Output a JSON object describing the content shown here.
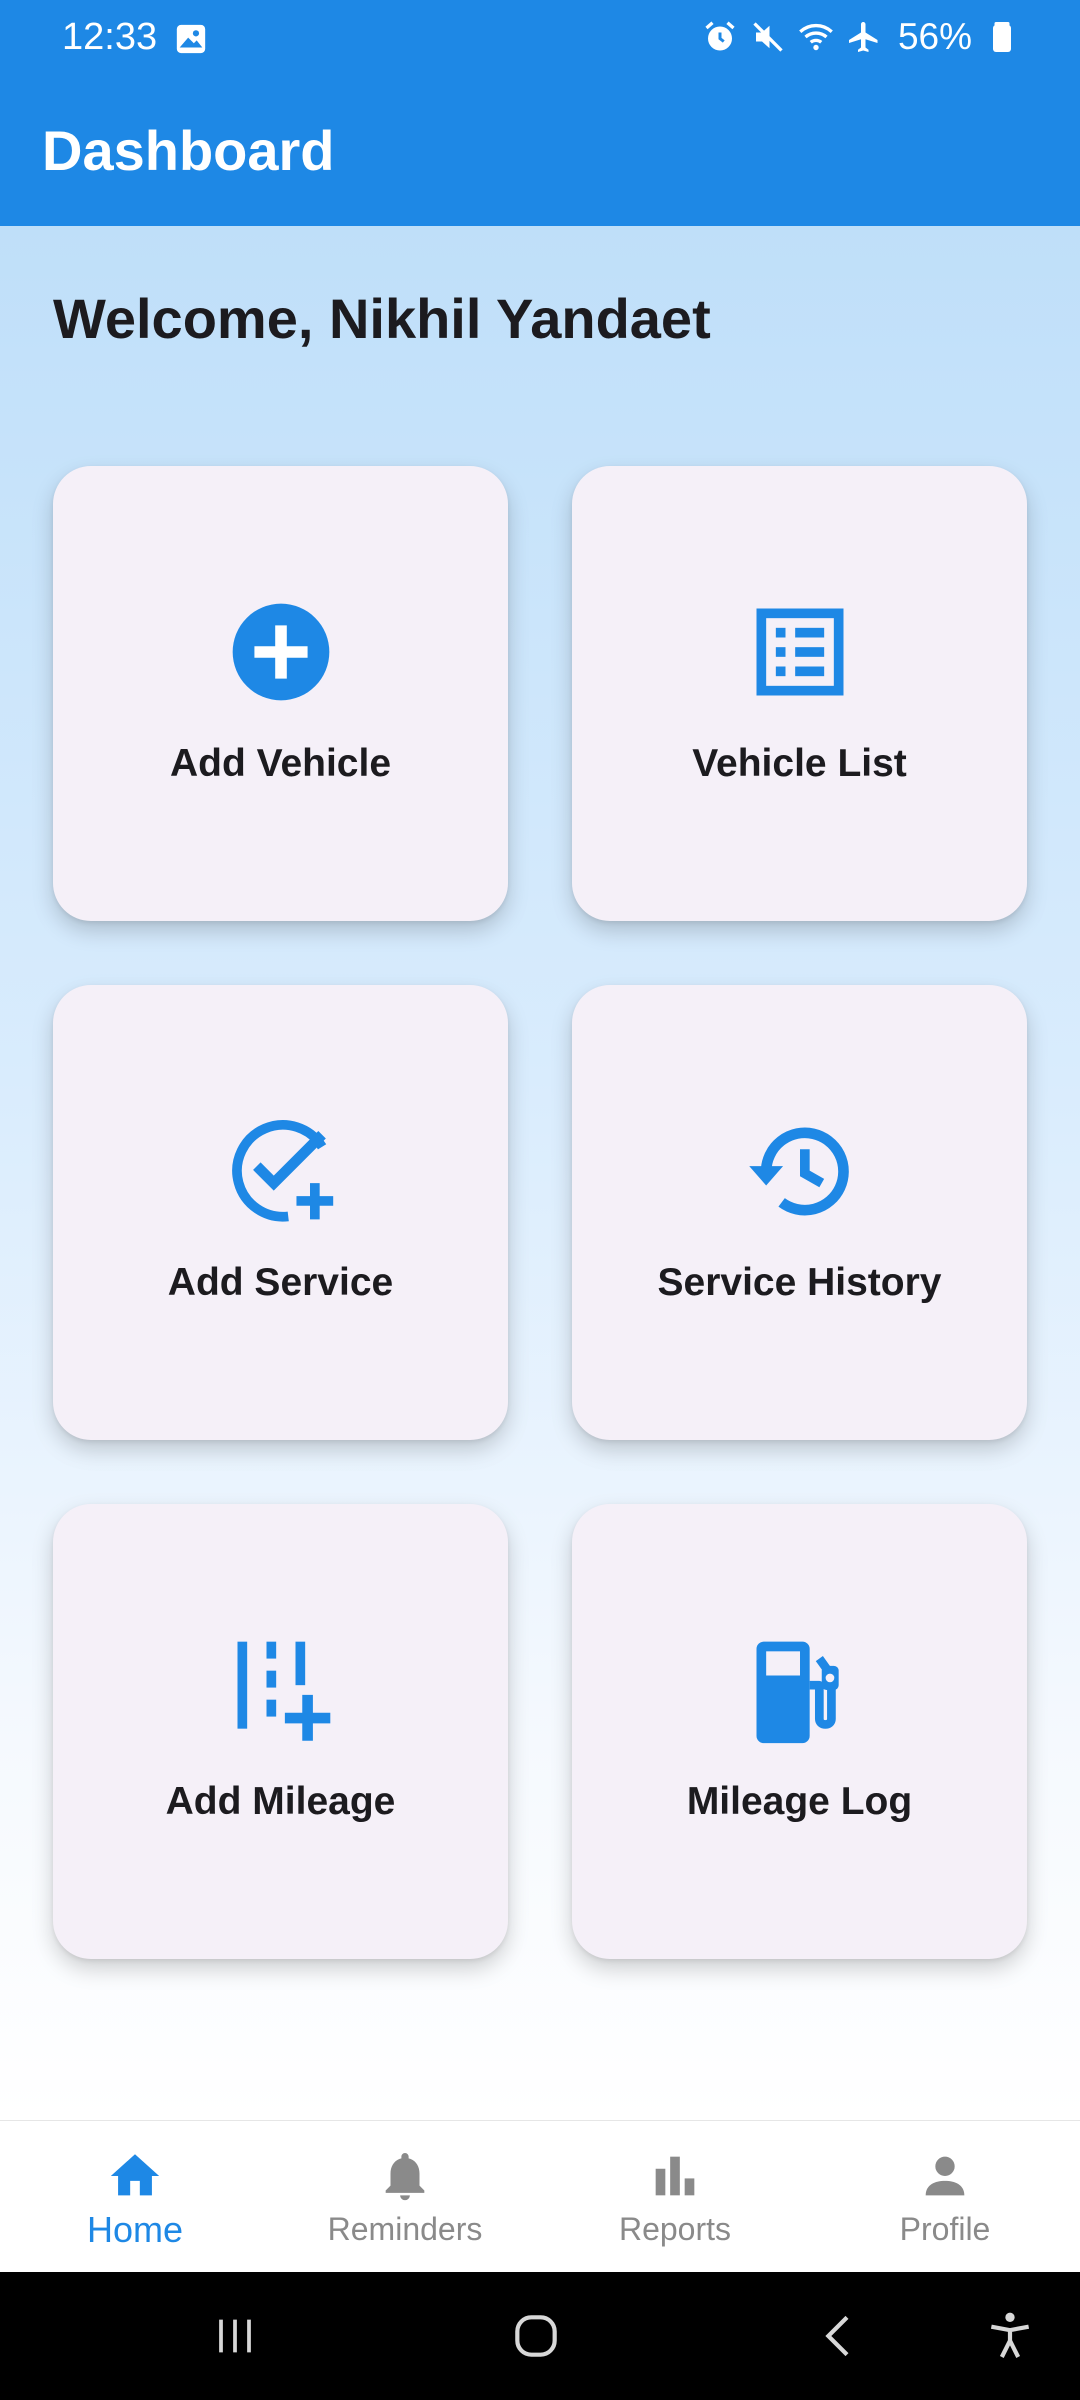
{
  "status_bar": {
    "time": "12:33",
    "battery": "56%",
    "icons": [
      "gallery-icon",
      "alarm-icon",
      "mute-icon",
      "wifi-icon",
      "airplane-icon",
      "battery-icon"
    ]
  },
  "app_bar": {
    "title": "Dashboard"
  },
  "welcome": "Welcome, Nikhil Yandaet",
  "cards": [
    {
      "label": "Add Vehicle",
      "icon": "add-circle-icon"
    },
    {
      "label": "Vehicle List",
      "icon": "list-icon"
    },
    {
      "label": "Add Service",
      "icon": "add-task-icon"
    },
    {
      "label": "Service History",
      "icon": "history-icon"
    },
    {
      "label": "Add Mileage",
      "icon": "add-mileage-icon"
    },
    {
      "label": "Mileage Log",
      "icon": "fuel-pump-icon"
    }
  ],
  "bottom_nav": {
    "active": "Home",
    "items": [
      {
        "label": "Home",
        "icon": "home-icon"
      },
      {
        "label": "Reminders",
        "icon": "bell-icon"
      },
      {
        "label": "Reports",
        "icon": "bar-chart-icon"
      },
      {
        "label": "Profile",
        "icon": "person-icon"
      }
    ]
  },
  "colors": {
    "primary": "#1e88e5",
    "card_bg": "#f5f0f8",
    "text_dark": "#1c1b1f",
    "nav_inactive": "#8a8a8a"
  }
}
